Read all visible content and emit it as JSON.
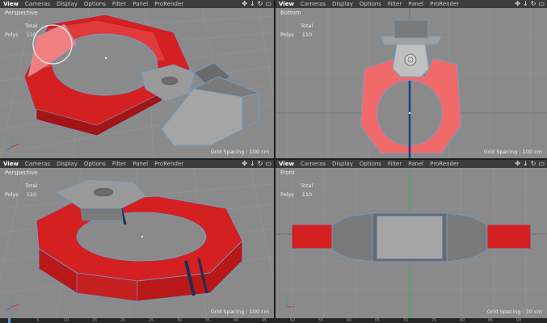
{
  "viewports": [
    {
      "camera": "Perspective",
      "menu": [
        "View",
        "Cameras",
        "Display",
        "Options",
        "Filter",
        "Panel",
        "ProRender"
      ],
      "stats": {
        "total_label": "Total",
        "polys_label": "Polys",
        "polys_value": "110"
      },
      "grid_spacing": "Grid Spacing : 100 cm"
    },
    {
      "camera": "Bottom",
      "menu": [
        "View",
        "Cameras",
        "Display",
        "Options",
        "Filter",
        "Panel",
        "ProRender"
      ],
      "stats": {
        "total_label": "Total",
        "polys_label": "Polys",
        "polys_value": "110"
      },
      "grid_spacing": "Grid Spacing : 100 cm"
    },
    {
      "camera": "Perspective",
      "menu": [
        "View",
        "Cameras",
        "Display",
        "Options",
        "Filter",
        "Panel",
        "ProRender"
      ],
      "stats": {
        "total_label": "Total",
        "polys_label": "Polys",
        "polys_value": "110"
      },
      "grid_spacing": "Grid Spacing : 100 cm"
    },
    {
      "camera": "Front",
      "menu": [
        "View",
        "Cameras",
        "Display",
        "Options",
        "Filter",
        "Panel",
        "ProRender"
      ],
      "stats": {
        "total_label": "Total",
        "polys_label": "Polys",
        "polys_value": "110"
      },
      "grid_spacing": "Grid Spacing : 10 cm"
    }
  ],
  "nav_icons": [
    "move-view-icon",
    "dolly-view-icon",
    "rotate-view-icon",
    "maximize-view-icon"
  ],
  "timeline": {
    "labels": [
      "0",
      "5",
      "10",
      "15",
      "20",
      "25",
      "30",
      "35",
      "40",
      "45",
      "50",
      "55",
      "60",
      "65",
      "70",
      "75",
      "80",
      "85",
      "90"
    ]
  },
  "colors": {
    "viewport_bg": "#8a8a8a",
    "menubar_bg": "#3c3c3c",
    "model_red": "#d42020",
    "model_red_selected": "#f06a6a",
    "model_grey": "#8e8e8e",
    "edge_blue": "#6aa0d8",
    "axis_green": "#29b54a",
    "axis_red": "#d03030",
    "axis_blue": "#3060d0"
  }
}
